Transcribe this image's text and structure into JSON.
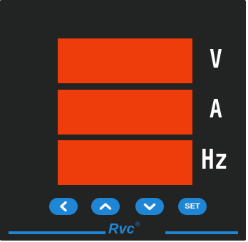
{
  "displays": [
    {
      "unit": "V"
    },
    {
      "unit": "A"
    },
    {
      "unit": "Hz"
    }
  ],
  "buttons": {
    "left_icon": "chevron-left-icon",
    "up_icon": "chevron-up-icon",
    "down_icon": "chevron-down-icon",
    "set_label": "SET"
  },
  "brand": {
    "name": "Rvc",
    "registered": "®"
  },
  "colors": {
    "bezel": "#222323",
    "display": "#ee3d0a",
    "accent": "#1f86d6",
    "unit_text": "#ffffff"
  }
}
